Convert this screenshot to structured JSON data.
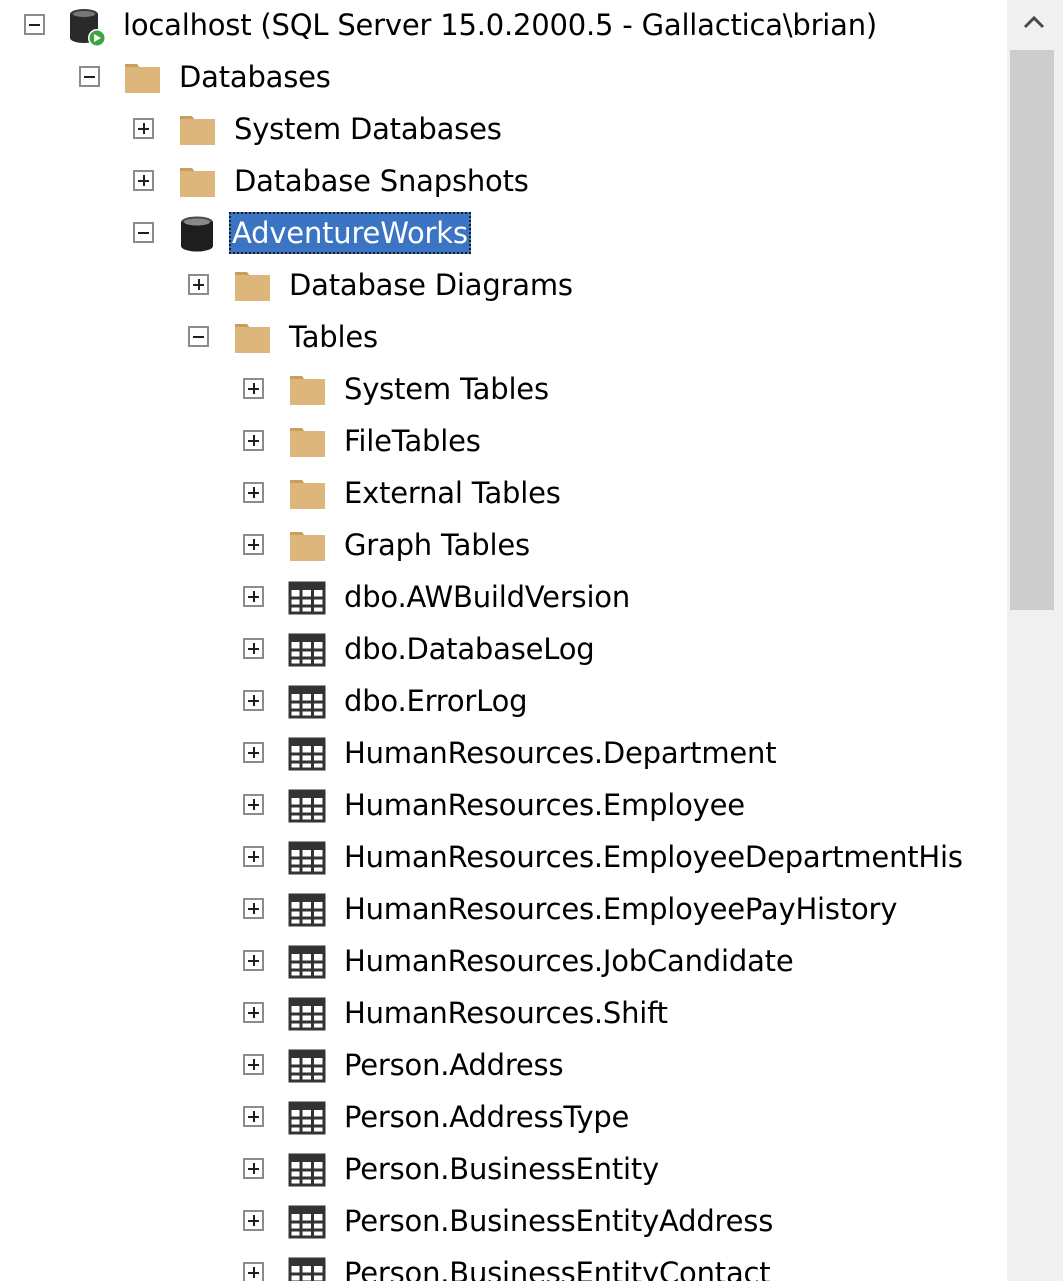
{
  "tree": {
    "server": {
      "label": "localhost (SQL Server 15.0.2000.5 - Gallactica\\brian)",
      "icon": "server-icon",
      "state": "expanded"
    },
    "databases": {
      "label": "Databases",
      "icon": "folder-icon",
      "state": "expanded"
    },
    "system_databases": {
      "label": "System Databases",
      "icon": "folder-icon",
      "state": "collapsed"
    },
    "database_snapshots": {
      "label": "Database Snapshots",
      "icon": "folder-icon",
      "state": "collapsed"
    },
    "adventureworks": {
      "label": "AdventureWorks",
      "icon": "database-icon",
      "state": "expanded",
      "selected": true
    },
    "database_diagrams": {
      "label": "Database Diagrams",
      "icon": "folder-icon",
      "state": "collapsed"
    },
    "tables": {
      "label": "Tables",
      "icon": "folder-icon",
      "state": "expanded"
    },
    "table_folders": [
      {
        "label": "System Tables",
        "icon": "folder-icon"
      },
      {
        "label": "FileTables",
        "icon": "folder-icon"
      },
      {
        "label": "External Tables",
        "icon": "folder-icon"
      },
      {
        "label": "Graph Tables",
        "icon": "folder-icon"
      }
    ],
    "table_items": [
      {
        "label": "dbo.AWBuildVersion",
        "icon": "table-icon"
      },
      {
        "label": "dbo.DatabaseLog",
        "icon": "table-icon"
      },
      {
        "label": "dbo.ErrorLog",
        "icon": "table-icon"
      },
      {
        "label": "HumanResources.Department",
        "icon": "table-icon"
      },
      {
        "label": "HumanResources.Employee",
        "icon": "table-icon"
      },
      {
        "label": "HumanResources.EmployeeDepartmentHis",
        "icon": "table-icon"
      },
      {
        "label": "HumanResources.EmployeePayHistory",
        "icon": "table-icon"
      },
      {
        "label": "HumanResources.JobCandidate",
        "icon": "table-icon"
      },
      {
        "label": "HumanResources.Shift",
        "icon": "table-icon"
      },
      {
        "label": "Person.Address",
        "icon": "table-icon"
      },
      {
        "label": "Person.AddressType",
        "icon": "table-icon"
      },
      {
        "label": "Person.BusinessEntity",
        "icon": "table-icon"
      },
      {
        "label": "Person.BusinessEntityAddress",
        "icon": "table-icon"
      },
      {
        "label": "Person.BusinessEntityContact",
        "icon": "table-icon"
      }
    ]
  },
  "scrollbar": {
    "up_icon": "chevron-up-icon"
  },
  "colors": {
    "folder": "#dcb67a",
    "folder_dark": "#c99e5a",
    "database": "#1e1e1e",
    "server_status": "#3fa33f",
    "selection": "#3a74c2",
    "table_icon": "#333333"
  }
}
